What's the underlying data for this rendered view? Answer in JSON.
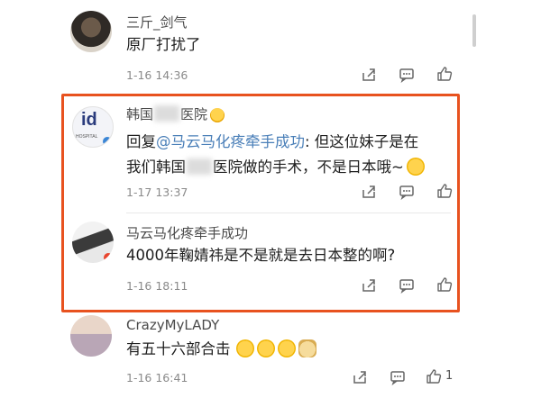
{
  "comments": [
    {
      "name": "三斤_剑气",
      "text": "原厂打扰了",
      "time": "1-16 14:36"
    },
    {
      "name_prefix": "韩国",
      "name_suffix": "医院",
      "avatar_label": "id",
      "avatar_sub": "HOSPITAL",
      "text_prefix": "回复",
      "mention": "@马云马化疼牵手成功",
      "text_rest": ": 但这位妹子是在",
      "text_line2_prefix": "我们韩国",
      "text_line2_rest": "医院做的手术，不是日本哦~",
      "time": "1-17 13:37"
    },
    {
      "name": "马云马化疼牵手成功",
      "text": "4000年鞠婧祎是不是就是去日本整的啊?",
      "time": "1-16 18:11"
    },
    {
      "name": "CrazyMyLADY",
      "text": "有五十六部合击",
      "time": "1-16 16:41",
      "like_count": "1"
    }
  ],
  "icons": {
    "share": "share-icon",
    "comment": "comment-icon",
    "like": "thumbs-up-icon"
  },
  "colors": {
    "highlight_border": "#e8521f",
    "mention": "#4a7fb8"
  }
}
